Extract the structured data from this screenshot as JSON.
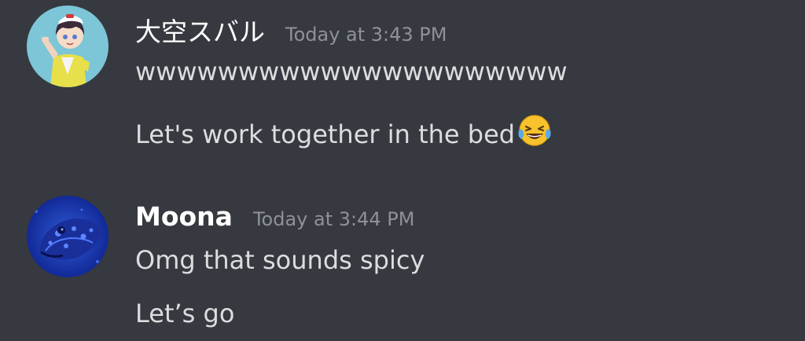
{
  "messages": [
    {
      "author": "大空スバル",
      "timestamp": "Today at 3:43 PM",
      "avatar_icon": "anime-avatar-icon",
      "lines": [
        "wwwwwwwwwwwwwwwwwwwww",
        "Let's work together in the bed"
      ],
      "emoji": "face-with-tears-of-joy-icon"
    },
    {
      "author": "Moona",
      "timestamp": "Today at 3:44 PM",
      "avatar_icon": "fish-avatar-icon",
      "lines": [
        "Omg that sounds spicy",
        "Let’s go"
      ]
    }
  ],
  "colors": {
    "background": "#36393f",
    "username": "#ffffff",
    "timestamp": "#8e9297",
    "text": "#dcddde"
  }
}
